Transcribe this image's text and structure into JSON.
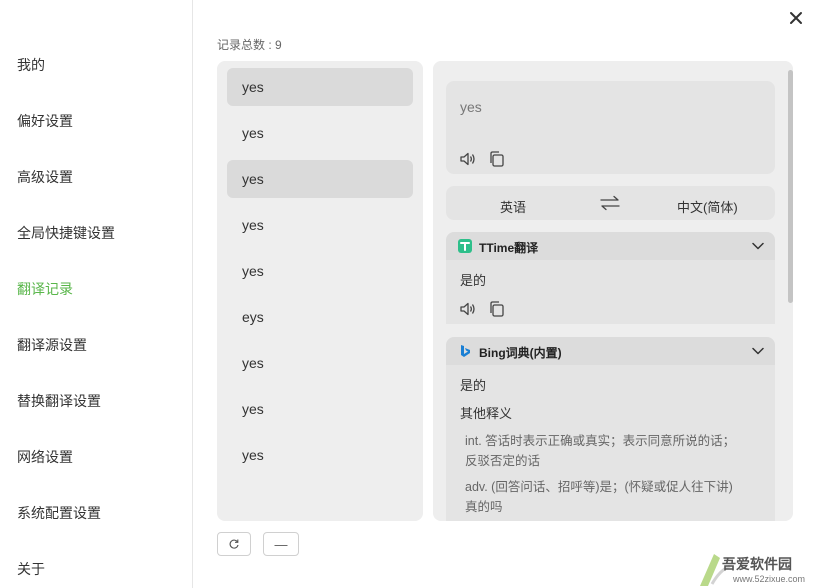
{
  "sidebar": {
    "items": [
      {
        "label": "我的"
      },
      {
        "label": "偏好设置"
      },
      {
        "label": "高级设置"
      },
      {
        "label": "全局快捷键设置"
      },
      {
        "label": "翻译记录"
      },
      {
        "label": "翻译源设置"
      },
      {
        "label": "替换翻译设置"
      },
      {
        "label": "网络设置"
      },
      {
        "label": "系统配置设置"
      },
      {
        "label": "关于"
      }
    ],
    "active_label": "翻译记录",
    "accent": "#59b64a"
  },
  "records": {
    "count_label": "记录总数 : 9",
    "items": [
      "yes",
      "yes",
      "yes",
      "yes",
      "yes",
      "eys",
      "yes",
      "yes",
      "yes"
    ]
  },
  "detail": {
    "source_text": "yes",
    "source_lang": "英语",
    "target_lang": "中文(简体)",
    "engines": [
      {
        "name": "TTime翻译",
        "result": "是的"
      },
      {
        "name": "Bing词典(内置)",
        "result": "是的",
        "other_label": "其他释义",
        "defs": [
          "int. 答话时表示正确或真实；表示同意所说的话；",
          "反驳否定的话",
          "adv. (回答问话、招呼等)是；(怀疑或促人往下讲)",
          "真的吗"
        ]
      }
    ]
  },
  "controls": {
    "minus_label": "—"
  },
  "watermark": {
    "text": "吾爱软件园",
    "url": "www.52zixue.com"
  }
}
